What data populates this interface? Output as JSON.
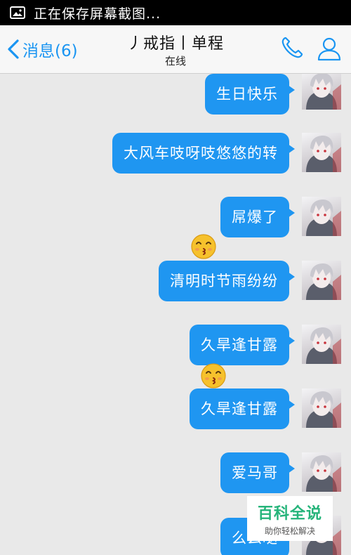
{
  "status_bar": {
    "icon": "gallery-icon",
    "text": "正在保存屏幕截图..."
  },
  "nav": {
    "back_label": "消息(6)",
    "title": "丿戒指丨单程",
    "subtitle": "在线",
    "call_icon": "phone-icon",
    "profile_icon": "profile-icon"
  },
  "messages": [
    {
      "text": "生日快乐"
    },
    {
      "text": "大风车吱呀吱悠悠的转"
    },
    {
      "text": "屌爆了"
    },
    {
      "text": "清明时节雨纷纷"
    },
    {
      "text": "久旱逢甘露"
    },
    {
      "text": "久旱逢甘露"
    },
    {
      "text": "爱马哥"
    },
    {
      "text": "么么哒"
    }
  ],
  "emojis": [
    "kissing-emoji",
    "kissing-emoji"
  ],
  "watermark": {
    "main": "百科全说",
    "sub": "助你轻松解决"
  },
  "colors": {
    "bubble": "#1f96f1",
    "accent": "#1a95f2",
    "watermark": "#25b47a"
  }
}
